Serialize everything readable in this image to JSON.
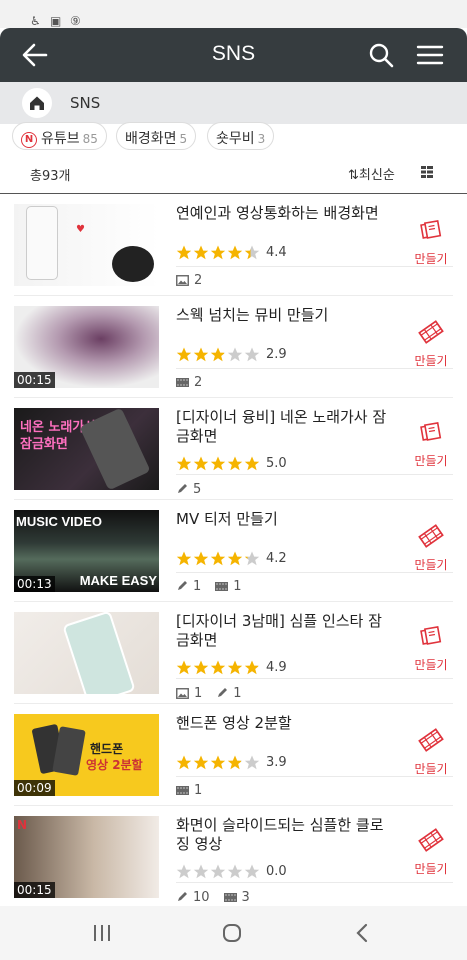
{
  "app_bar": {
    "title": "SNS"
  },
  "breadcrumb": {
    "label": "SNS"
  },
  "chips": [
    {
      "label": "유튜브",
      "count": "85",
      "badge": "N"
    },
    {
      "label": "배경화면",
      "count": "5"
    },
    {
      "label": "숏무비",
      "count": "3"
    }
  ],
  "list_bar": {
    "total": "총93개",
    "sort_label": "최신순"
  },
  "items": [
    {
      "title": "연예인과 영상통화하는 배경화면",
      "rating": 4.4,
      "rating_text": "4.4",
      "meta": [
        {
          "icon": "image-icon",
          "value": "2"
        }
      ],
      "action": "만들기",
      "action_icon": "template-icon"
    },
    {
      "title": "스웩 넘치는 뮤비 만들기",
      "rating": 2.9,
      "rating_text": "2.9",
      "duration": "00:15",
      "meta": [
        {
          "icon": "film-icon",
          "value": "2"
        }
      ],
      "action": "만들기",
      "action_icon": "film-icon"
    },
    {
      "title": "[디자이너 융비] 네온 노래가사 잠금화면",
      "rating": 5.0,
      "rating_text": "5.0",
      "meta": [
        {
          "icon": "pencil-icon",
          "value": "5"
        }
      ],
      "action": "만들기",
      "action_icon": "template-icon",
      "thumb_text": [
        "네온 노래가사",
        "잠금화면"
      ]
    },
    {
      "title": "MV 티저 만들기",
      "rating": 4.2,
      "rating_text": "4.2",
      "duration": "00:13",
      "meta": [
        {
          "icon": "pencil-icon",
          "value": "1"
        },
        {
          "icon": "film-icon",
          "value": "1"
        }
      ],
      "action": "만들기",
      "action_icon": "film-icon",
      "thumb_text": [
        "MUSIC VIDEO",
        "MAKE EASY"
      ]
    },
    {
      "title": "[디자이너 3남매] 심플 인스타 잠금화면",
      "rating": 4.9,
      "rating_text": "4.9",
      "meta": [
        {
          "icon": "image-icon",
          "value": "1"
        },
        {
          "icon": "pencil-icon",
          "value": "1"
        }
      ],
      "action": "만들기",
      "action_icon": "template-icon"
    },
    {
      "title": "핸드폰 영상 2분할",
      "rating": 3.9,
      "rating_text": "3.9",
      "duration": "00:09",
      "meta": [
        {
          "icon": "film-icon",
          "value": "1"
        }
      ],
      "action": "만들기",
      "action_icon": "film-icon",
      "thumb_text": [
        "핸드폰",
        "영상 2분할"
      ]
    },
    {
      "title": "화면이 슬라이드되는 심플한 클로징 영상",
      "rating": 0.0,
      "rating_text": "0.0",
      "duration": "00:15",
      "meta": [
        {
          "icon": "pencil-icon",
          "value": "10"
        },
        {
          "icon": "film-icon",
          "value": "3"
        }
      ],
      "action": "만들기",
      "action_icon": "film-icon",
      "badge": "N"
    }
  ],
  "colors": {
    "accent": "#e0333c",
    "star_on": "#f5b400",
    "star_off": "#cccccc",
    "header_bg": "#363c3f"
  }
}
